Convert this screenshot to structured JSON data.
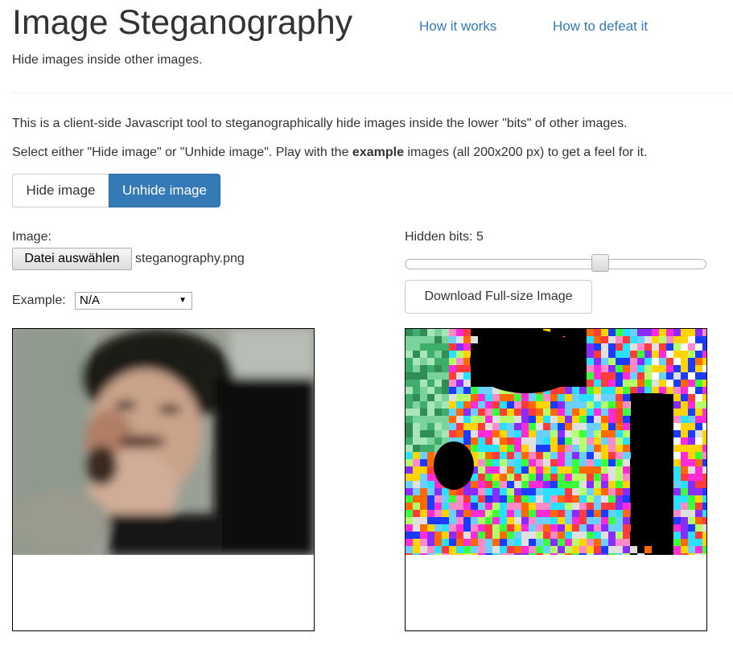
{
  "header": {
    "title": "Image Steganography",
    "subtitle": "Hide images inside other images.",
    "nav": [
      {
        "label": "How it works"
      },
      {
        "label": "How to defeat it"
      }
    ]
  },
  "intro": {
    "line1": "This is a client-side Javascript tool to steganographically hide images inside the lower \"bits\" of other images.",
    "line2_prefix": "Select either \"Hide image\" or \"Unhide image\". Play with the ",
    "line2_bold": "example",
    "line2_suffix": " images (all 200x200 px) to get a feel for it."
  },
  "mode": {
    "hide_label": "Hide image",
    "unhide_label": "Unhide image",
    "active": "Unhide image",
    "active_color": "#337ab7"
  },
  "left": {
    "image_label": "Image:",
    "file_button_label": "Datei auswählen",
    "file_name": "steganography.png",
    "example_label": "Example:",
    "example_selected": "N/A"
  },
  "right": {
    "hidden_bits_label": "Hidden bits:",
    "hidden_bits_value": "5",
    "hidden_bits_fraction": 0.66,
    "download_label": "Download Full-size Image"
  },
  "colors": {
    "link": "#337ab7",
    "primary": "#337ab7",
    "text": "#333333"
  }
}
